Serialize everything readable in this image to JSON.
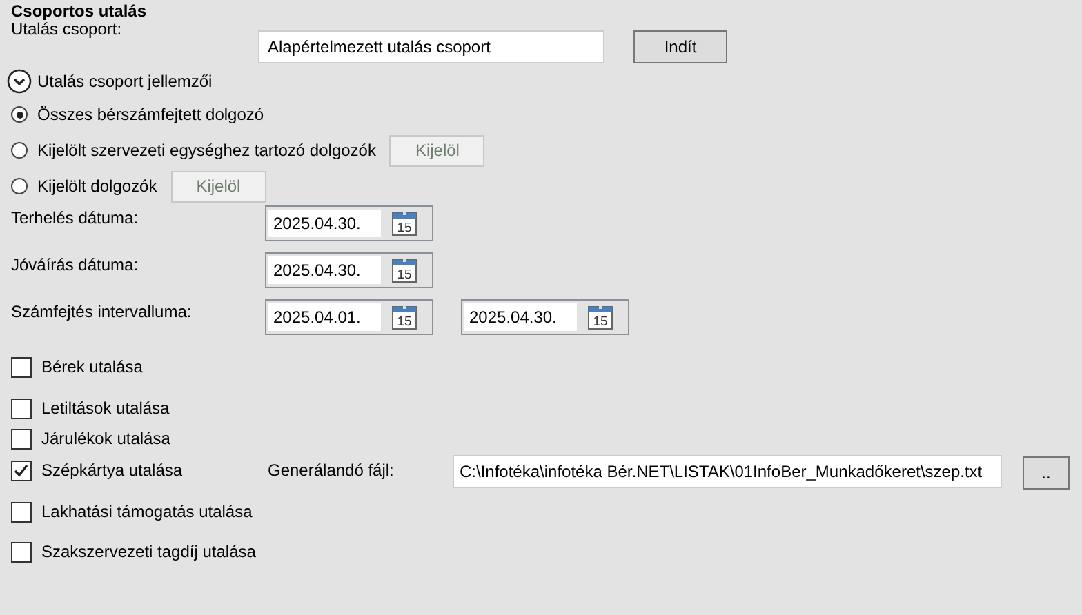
{
  "title": "Csoportos utalás",
  "group": {
    "label": "Utalás csoport:",
    "value": "Alapértelmezett utalás csoport",
    "button": "Indít"
  },
  "expander": {
    "label": "Utalás csoport jellemzői",
    "expanded": true
  },
  "radios": [
    {
      "label": "Összes bérszámfejtett dolgozó",
      "selected": true
    },
    {
      "label": "Kijelölt szervezeti egységhez tartozó dolgozók",
      "selected": false,
      "button": "Kijelöl"
    },
    {
      "label": "Kijelölt dolgozók",
      "selected": false,
      "button": "Kijelöl"
    }
  ],
  "dates": [
    {
      "label": "Terhelés dátuma:",
      "values": [
        {
          "value": "2025.04.30.",
          "calendar_day": "15"
        }
      ]
    },
    {
      "label": "Jóváírás dátuma:",
      "values": [
        {
          "value": "2025.04.30.",
          "calendar_day": "15"
        }
      ]
    },
    {
      "label": "Számfejtés intervalluma:",
      "values": [
        {
          "value": "2025.04.01.",
          "calendar_day": "15"
        },
        {
          "value": "2025.04.30.",
          "calendar_day": "15"
        }
      ]
    }
  ],
  "checkboxes": [
    {
      "label": "Bérek utalása",
      "checked": false
    },
    {
      "label": "Letiltások utalása",
      "checked": false
    },
    {
      "label": "Járulékok utalása",
      "checked": false
    },
    {
      "label": "Szépkártya utalása",
      "checked": true,
      "file": {
        "label": "Generálandó fájl:",
        "value": "C:\\Infotéka\\infotéka Bér.NET\\LISTAK\\01InfoBer_Munkadőkeret\\szep.txt",
        "button": ".."
      }
    },
    {
      "label": "Lakhatási támogatás utalása",
      "checked": false
    },
    {
      "label": "Szakszervezeti tagdíj utalása",
      "checked": false
    }
  ]
}
